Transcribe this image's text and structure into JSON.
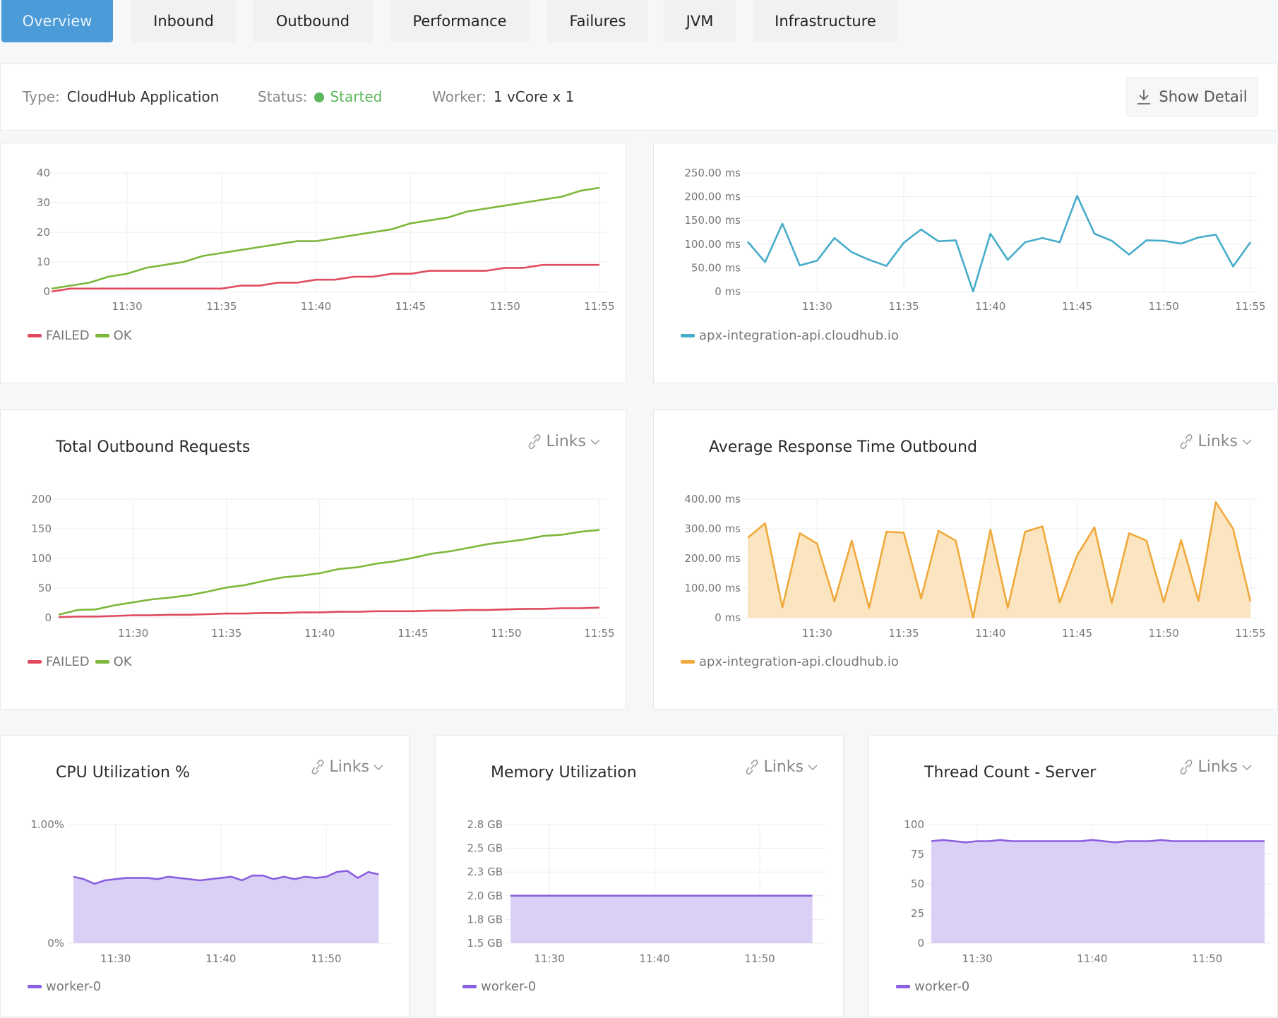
{
  "tabs": [
    {
      "label": "Overview",
      "active": true
    },
    {
      "label": "Inbound",
      "active": false
    },
    {
      "label": "Outbound",
      "active": false
    },
    {
      "label": "Performance",
      "active": false
    },
    {
      "label": "Failures",
      "active": false
    },
    {
      "label": "JVM",
      "active": false
    },
    {
      "label": "Infrastructure",
      "active": false
    }
  ],
  "info": {
    "type_label": "Type:",
    "type_value": "CloudHub Application",
    "status_label": "Status:",
    "status_value": "Started",
    "worker_label": "Worker:",
    "worker_value": "1 vCore x 1",
    "show_detail": "Show Detail"
  },
  "links_label": "Links",
  "colors": {
    "failed": "#e04a5f",
    "ok": "#7cb83a",
    "inbound_rt": "#45acc9",
    "outbound_rt": "#f0a93a",
    "outbound_rt_fill": "#fbe3bd",
    "worker": "#8a5fe0",
    "worker_fill": "#d8cdf6",
    "status_ok": "#5cb85c",
    "tab_active": "#4a9bd8"
  },
  "chart_data": [
    {
      "id": "inbound-requests",
      "type": "line",
      "title": "",
      "x": [
        "11:26",
        "11:27",
        "11:28",
        "11:29",
        "11:30",
        "11:31",
        "11:32",
        "11:33",
        "11:34",
        "11:35",
        "11:36",
        "11:37",
        "11:38",
        "11:39",
        "11:40",
        "11:41",
        "11:42",
        "11:43",
        "11:44",
        "11:45",
        "11:46",
        "11:47",
        "11:48",
        "11:49",
        "11:50",
        "11:51",
        "11:52",
        "11:53",
        "11:54",
        "11:55"
      ],
      "xticks": [
        "11:30",
        "11:35",
        "11:40",
        "11:45",
        "11:50",
        "11:55"
      ],
      "yticks": [
        "0",
        "10",
        "20",
        "30",
        "40"
      ],
      "ylim": [
        0,
        40
      ],
      "series": [
        {
          "name": "FAILED",
          "color_key": "failed",
          "values": [
            0,
            1,
            1,
            1,
            1,
            1,
            1,
            1,
            1,
            1,
            2,
            2,
            3,
            3,
            4,
            4,
            5,
            5,
            6,
            6,
            7,
            7,
            7,
            7,
            8,
            8,
            9,
            9,
            9,
            9
          ]
        },
        {
          "name": "OK",
          "color_key": "ok",
          "values": [
            1,
            2,
            3,
            5,
            6,
            8,
            9,
            10,
            12,
            13,
            14,
            15,
            16,
            17,
            17,
            18,
            19,
            20,
            21,
            23,
            24,
            25,
            27,
            28,
            29,
            30,
            31,
            32,
            34,
            35
          ]
        }
      ],
      "legend": [
        "FAILED",
        "OK"
      ]
    },
    {
      "id": "inbound-response-time",
      "type": "line",
      "title": "",
      "x": [
        "11:26",
        "11:27",
        "11:28",
        "11:29",
        "11:30",
        "11:31",
        "11:32",
        "11:33",
        "11:34",
        "11:35",
        "11:36",
        "11:37",
        "11:38",
        "11:39",
        "11:40",
        "11:41",
        "11:42",
        "11:43",
        "11:44",
        "11:45",
        "11:46",
        "11:47",
        "11:48",
        "11:49",
        "11:50",
        "11:51",
        "11:52",
        "11:53",
        "11:54",
        "11:55"
      ],
      "xticks": [
        "11:30",
        "11:35",
        "11:40",
        "11:45",
        "11:50",
        "11:55"
      ],
      "yticks": [
        "0 ms",
        "50.00 ms",
        "100.00 ms",
        "150.00 ms",
        "200.00 ms",
        "250.00 ms"
      ],
      "ylim": [
        0,
        250
      ],
      "series": [
        {
          "name": "apx-integration-api.cloudhub.io",
          "color_key": "inbound_rt",
          "values": [
            105,
            62,
            143,
            55,
            65,
            113,
            83,
            67,
            54,
            103,
            131,
            106,
            108,
            0,
            122,
            67,
            104,
            113,
            104,
            202,
            122,
            107,
            78,
            108,
            107,
            101,
            114,
            120,
            53,
            104
          ]
        }
      ],
      "legend": [
        "apx-integration-api.cloudhub.io"
      ]
    },
    {
      "id": "total-outbound-requests",
      "type": "line",
      "title": "Total Outbound Requests",
      "x": [
        "11:26",
        "11:27",
        "11:28",
        "11:29",
        "11:30",
        "11:31",
        "11:32",
        "11:33",
        "11:34",
        "11:35",
        "11:36",
        "11:37",
        "11:38",
        "11:39",
        "11:40",
        "11:41",
        "11:42",
        "11:43",
        "11:44",
        "11:45",
        "11:46",
        "11:47",
        "11:48",
        "11:49",
        "11:50",
        "11:51",
        "11:52",
        "11:53",
        "11:54",
        "11:55"
      ],
      "xticks": [
        "11:30",
        "11:35",
        "11:40",
        "11:45",
        "11:50",
        "11:55"
      ],
      "yticks": [
        "0",
        "50",
        "100",
        "150",
        "200"
      ],
      "ylim": [
        0,
        200
      ],
      "series": [
        {
          "name": "FAILED",
          "color_key": "failed",
          "values": [
            1,
            2,
            2,
            3,
            4,
            4,
            5,
            5,
            6,
            7,
            7,
            8,
            8,
            9,
            9,
            10,
            10,
            11,
            11,
            11,
            12,
            12,
            13,
            13,
            14,
            15,
            15,
            16,
            16,
            17
          ]
        },
        {
          "name": "OK",
          "color_key": "ok",
          "values": [
            5,
            13,
            14,
            21,
            26,
            31,
            34,
            38,
            44,
            51,
            55,
            62,
            68,
            71,
            75,
            82,
            85,
            91,
            95,
            101,
            108,
            112,
            118,
            124,
            128,
            132,
            138,
            140,
            145,
            148
          ]
        }
      ],
      "legend": [
        "FAILED",
        "OK"
      ]
    },
    {
      "id": "average-response-time-outbound",
      "type": "area",
      "title": "Average Response Time Outbound",
      "x": [
        "11:26",
        "11:27",
        "11:28",
        "11:29",
        "11:30",
        "11:31",
        "11:32",
        "11:33",
        "11:34",
        "11:35",
        "11:36",
        "11:37",
        "11:38",
        "11:39",
        "11:40",
        "11:41",
        "11:42",
        "11:43",
        "11:44",
        "11:45",
        "11:46",
        "11:47",
        "11:48",
        "11:49",
        "11:50",
        "11:51",
        "11:52",
        "11:53",
        "11:54",
        "11:55"
      ],
      "xticks": [
        "11:30",
        "11:35",
        "11:40",
        "11:45",
        "11:50",
        "11:55"
      ],
      "yticks": [
        "0 ms",
        "100.00 ms",
        "200.00 ms",
        "300.00 ms",
        "400.00 ms"
      ],
      "ylim": [
        0,
        400
      ],
      "series": [
        {
          "name": "apx-integration-api.cloudhub.io",
          "color_key": "outbound_rt",
          "values": [
            270,
            318,
            35,
            285,
            250,
            55,
            260,
            33,
            290,
            287,
            65,
            293,
            260,
            0,
            297,
            33,
            290,
            308,
            52,
            210,
            305,
            50,
            285,
            260,
            53,
            262,
            57,
            390,
            300,
            55
          ]
        }
      ],
      "legend": [
        "apx-integration-api.cloudhub.io"
      ]
    },
    {
      "id": "cpu-utilization",
      "type": "area",
      "title": "CPU Utilization %",
      "x": [
        "11:26",
        "11:27",
        "11:28",
        "11:29",
        "11:30",
        "11:31",
        "11:32",
        "11:33",
        "11:34",
        "11:35",
        "11:36",
        "11:37",
        "11:38",
        "11:39",
        "11:40",
        "11:41",
        "11:42",
        "11:43",
        "11:44",
        "11:45",
        "11:46",
        "11:47",
        "11:48",
        "11:49",
        "11:50",
        "11:51",
        "11:52",
        "11:53",
        "11:54",
        "11:55"
      ],
      "xticks": [
        "11:30",
        "11:40",
        "11:50"
      ],
      "yticks": [
        "0%",
        "1.00%"
      ],
      "ylim": [
        0,
        1
      ],
      "series": [
        {
          "name": "worker-0",
          "color_key": "worker",
          "values": [
            0.56,
            0.54,
            0.5,
            0.53,
            0.54,
            0.55,
            0.55,
            0.55,
            0.54,
            0.56,
            0.55,
            0.54,
            0.53,
            0.54,
            0.55,
            0.56,
            0.53,
            0.57,
            0.57,
            0.54,
            0.56,
            0.54,
            0.56,
            0.55,
            0.56,
            0.6,
            0.61,
            0.55,
            0.6,
            0.58
          ]
        }
      ],
      "legend": [
        "worker-0"
      ]
    },
    {
      "id": "memory-utilization",
      "type": "area",
      "title": "Memory Utilization",
      "x": [
        "11:26",
        "11:55"
      ],
      "xticks": [
        "11:30",
        "11:40",
        "11:50"
      ],
      "yticks": [
        "1.5 GB",
        "1.8 GB",
        "2.0 GB",
        "2.3 GB",
        "2.5 GB",
        "2.8 GB"
      ],
      "ylim": [
        1.5,
        2.75
      ],
      "series": [
        {
          "name": "worker-0",
          "color_key": "worker",
          "values": [
            2.0,
            2.0
          ]
        }
      ],
      "legend": [
        "worker-0"
      ]
    },
    {
      "id": "thread-count-server",
      "type": "area",
      "title": "Thread Count - Server",
      "x": [
        "11:26",
        "11:27",
        "11:28",
        "11:29",
        "11:30",
        "11:31",
        "11:32",
        "11:33",
        "11:34",
        "11:35",
        "11:36",
        "11:37",
        "11:38",
        "11:39",
        "11:40",
        "11:41",
        "11:42",
        "11:43",
        "11:44",
        "11:45",
        "11:46",
        "11:47",
        "11:48",
        "11:49",
        "11:50",
        "11:51",
        "11:52",
        "11:53",
        "11:54",
        "11:55"
      ],
      "xticks": [
        "11:30",
        "11:40",
        "11:50"
      ],
      "yticks": [
        "0",
        "25",
        "50",
        "75",
        "100"
      ],
      "ylim": [
        0,
        100
      ],
      "series": [
        {
          "name": "worker-0",
          "color_key": "worker",
          "values": [
            86,
            87,
            86,
            85,
            86,
            86,
            87,
            86,
            86,
            86,
            86,
            86,
            86,
            86,
            87,
            86,
            85,
            86,
            86,
            86,
            87,
            86,
            86,
            86,
            86,
            86,
            86,
            86,
            86,
            86
          ]
        }
      ],
      "legend": [
        "worker-0"
      ]
    }
  ]
}
